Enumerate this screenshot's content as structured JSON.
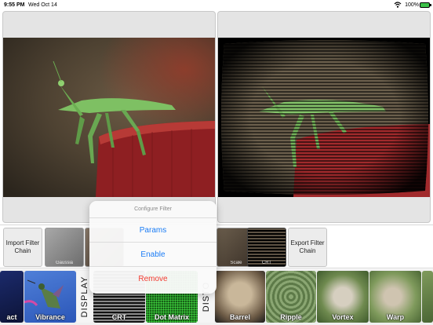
{
  "status_bar": {
    "time": "9:55 PM",
    "date": "Wed Oct 14",
    "battery": "100%"
  },
  "chain": {
    "import_label": "Import Filter Chain",
    "export_label": "Export Filter Chain",
    "thumbs": [
      "Gaussia",
      "Scale",
      "CRT"
    ]
  },
  "popover": {
    "title": "Configure Filter",
    "items": [
      "Params",
      "Enable",
      "Remove"
    ]
  },
  "strip": {
    "tiles": [
      "act",
      "Vibrance",
      "CRT",
      "Dot Matrix",
      "Barrel",
      "Ripple",
      "Vortex",
      "Warp"
    ],
    "categories": [
      "DISPLAY",
      "DISTO"
    ]
  },
  "colors": {
    "accent": "#1a7cf5",
    "destructive": "#f23b30",
    "battery": "#3cc24a"
  }
}
